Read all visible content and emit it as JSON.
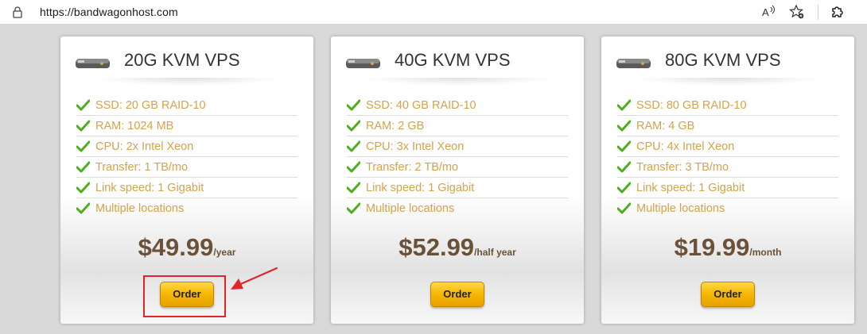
{
  "browser": {
    "url": "https://bandwagonhost.com",
    "icons": [
      "lock-icon",
      "read-aloud-icon",
      "favorite-icon",
      "extensions-icon"
    ]
  },
  "plans": [
    {
      "title": "20G KVM VPS",
      "features": [
        "SSD: 20 GB RAID-10",
        "RAM: 1024 MB",
        "CPU: 2x Intel Xeon",
        "Transfer: 1 TB/mo",
        "Link speed: 1 Gigabit",
        "Multiple locations"
      ],
      "price": "$49.99",
      "period": "/year",
      "order_label": "Order"
    },
    {
      "title": "40G KVM VPS",
      "features": [
        "SSD: 40 GB RAID-10",
        "RAM: 2 GB",
        "CPU: 3x Intel Xeon",
        "Transfer: 2 TB/mo",
        "Link speed: 1 Gigabit",
        "Multiple locations"
      ],
      "price": "$52.99",
      "period": "/half year",
      "order_label": "Order"
    },
    {
      "title": "80G KVM VPS",
      "features": [
        "SSD: 80 GB RAID-10",
        "RAM: 4 GB",
        "CPU: 4x Intel Xeon",
        "Transfer: 3 TB/mo",
        "Link speed: 1 Gigabit",
        "Multiple locations"
      ],
      "price": "$19.99",
      "period": "/month",
      "order_label": "Order"
    }
  ],
  "colors": {
    "feature_text": "#d6a24a",
    "price_text": "#6b5138",
    "button": "#f5b600",
    "check": "#4caf1e",
    "annotation": "#e0242a"
  }
}
